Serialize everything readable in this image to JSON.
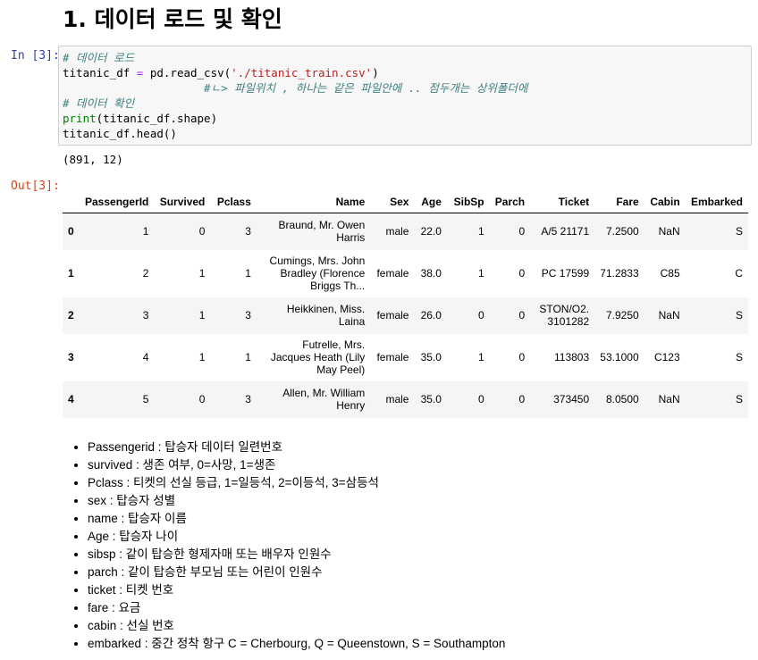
{
  "heading": "1. 데이터 로드 및 확인",
  "input_prompt": "In [3]:",
  "output_prompt": "Out[3]:",
  "code": {
    "line1_comment": "# 데이터 로드",
    "line2_var": "titanic_df",
    "line2_eq": " = ",
    "line2_call": "pd.read_csv(",
    "line2_str": "'./titanic_train.csv'",
    "line2_close": ")",
    "line3_comment": "#ㄴ> 파일위치 , 하나는 같은 파일안에 .. 점두개는 상위폴더에",
    "line4_comment": "# 데이터 확인",
    "line5_print": "print",
    "line5_rest": "(titanic_df.shape)",
    "line6": "titanic_df.head()"
  },
  "shape_output": "(891, 12)",
  "table": {
    "columns": [
      "",
      "PassengerId",
      "Survived",
      "Pclass",
      "Name",
      "Sex",
      "Age",
      "SibSp",
      "Parch",
      "Ticket",
      "Fare",
      "Cabin",
      "Embarked"
    ],
    "rows": [
      [
        "0",
        "1",
        "0",
        "3",
        "Braund, Mr. Owen Harris",
        "male",
        "22.0",
        "1",
        "0",
        "A/5 21171",
        "7.2500",
        "NaN",
        "S"
      ],
      [
        "1",
        "2",
        "1",
        "1",
        "Cumings, Mrs. John Bradley (Florence Briggs Th...",
        "female",
        "38.0",
        "1",
        "0",
        "PC 17599",
        "71.2833",
        "C85",
        "C"
      ],
      [
        "2",
        "3",
        "1",
        "3",
        "Heikkinen, Miss. Laina",
        "female",
        "26.0",
        "0",
        "0",
        "STON/O2. 3101282",
        "7.9250",
        "NaN",
        "S"
      ],
      [
        "3",
        "4",
        "1",
        "1",
        "Futrelle, Mrs. Jacques Heath (Lily May Peel)",
        "female",
        "35.0",
        "1",
        "0",
        "113803",
        "53.1000",
        "C123",
        "S"
      ],
      [
        "4",
        "5",
        "0",
        "3",
        "Allen, Mr. William Henry",
        "male",
        "35.0",
        "0",
        "0",
        "373450",
        "8.0500",
        "NaN",
        "S"
      ]
    ]
  },
  "notes": [
    "Passengerid : 탑승자 데이터 일련번호",
    "survived : 생존 여부, 0=사망, 1=생존",
    "Pclass : 티켓의 선실 등급, 1=일등석, 2=이등석, 3=삼등석",
    "sex : 탑승자 성별",
    "name : 탑승자 이름",
    "Age : 탑승자 나이",
    "sibsp : 같이 탑승한 형제자매 또는 배우자 인원수",
    "parch : 같이 탑승한 부모님 또는 어린이 인원수",
    "ticket : 티켓 번호",
    "fare : 요금",
    "cabin : 선실 번호",
    "embarked : 중간 정착 항구 C = Cherbourg, Q = Queenstown, S = Southampton"
  ]
}
